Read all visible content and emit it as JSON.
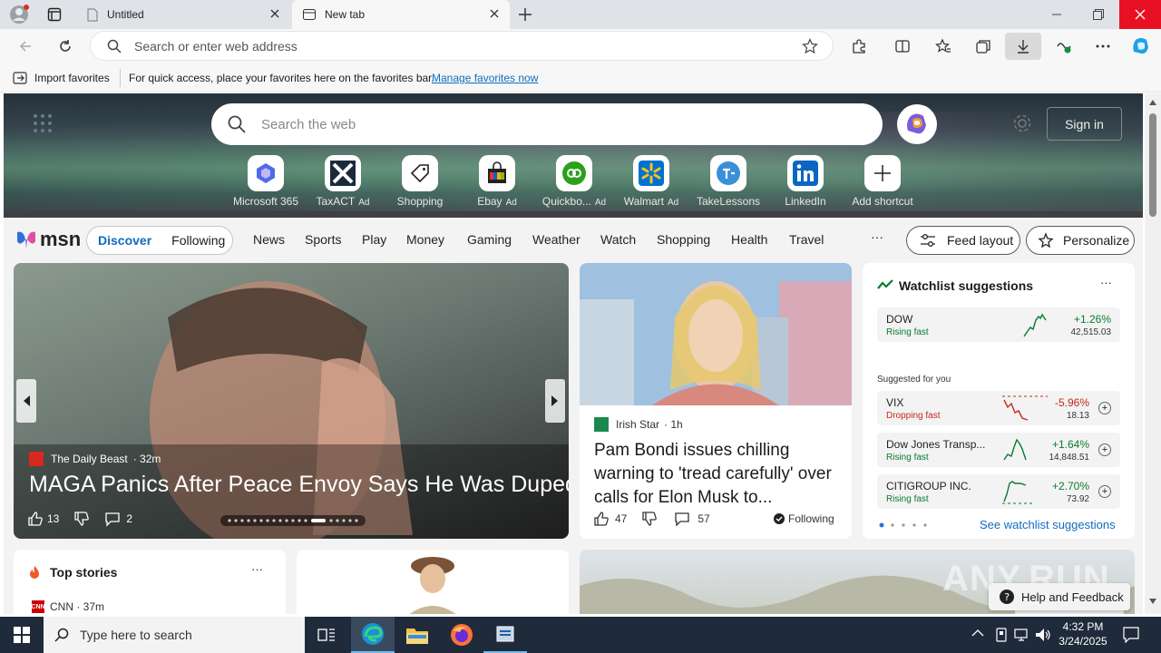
{
  "browser": {
    "tabs": [
      {
        "title": "Untitled"
      },
      {
        "title": "New tab"
      }
    ],
    "address_placeholder": "Search or enter web address"
  },
  "favorites_bar": {
    "import_label": "Import favorites",
    "message": "For quick access, place your favorites here on the favorites bar.",
    "manage_link": "Manage favorites now"
  },
  "new_tab": {
    "search_placeholder": "Search the web",
    "sign_in": "Sign in",
    "shortcuts": [
      {
        "label": "Microsoft 365",
        "ad": ""
      },
      {
        "label": "TaxACT",
        "ad": "Ad"
      },
      {
        "label": "Shopping",
        "ad": ""
      },
      {
        "label": "Ebay",
        "ad": "Ad"
      },
      {
        "label": "Quickbo...",
        "ad": "Ad"
      },
      {
        "label": "Walmart",
        "ad": "Ad"
      },
      {
        "label": "TakeLessons",
        "ad": ""
      },
      {
        "label": "LinkedIn",
        "ad": ""
      },
      {
        "label": "Add shortcut",
        "ad": ""
      }
    ]
  },
  "msn_nav": {
    "brand": "msn",
    "discover": "Discover",
    "following": "Following",
    "items": [
      "News",
      "Sports",
      "Play",
      "Money",
      "Gaming",
      "Weather",
      "Watch",
      "Shopping",
      "Health",
      "Travel"
    ],
    "more": "···",
    "feed_layout": "Feed layout",
    "personalize": "Personalize"
  },
  "hero_story": {
    "source": "The Daily Beast",
    "time": "· 32m",
    "headline": "MAGA Panics After Peace Envoy Says He Was Duped",
    "likes": "13",
    "comments": "2"
  },
  "story2": {
    "source": "Irish Star",
    "time": "· 1h",
    "headline": "Pam Bondi issues chilling warning to 'tread carefully' over calls for Elon Musk to...",
    "likes": "47",
    "comments": "57",
    "following": "Following"
  },
  "watchlist": {
    "title": "Watchlist suggestions",
    "more": "···",
    "suggested_label": "Suggested for you",
    "see_more": "See watchlist suggestions",
    "items": [
      {
        "name": "DOW",
        "status": "Rising fast",
        "change": "+1.26%",
        "value": "42,515.03",
        "color": "#0a7b2e"
      },
      {
        "name": "VIX",
        "status": "Dropping fast",
        "change": "-5.96%",
        "value": "18.13",
        "color": "#c5281c"
      },
      {
        "name": "Dow Jones Transp...",
        "status": "Rising fast",
        "change": "+1.64%",
        "value": "14,848.51",
        "color": "#0a7b2e"
      },
      {
        "name": "CITIGROUP INC.",
        "status": "Rising fast",
        "change": "+2.70%",
        "value": "73.92",
        "color": "#0a7b2e"
      }
    ]
  },
  "top_stories": {
    "title": "Top stories",
    "more": "···",
    "first_source": "CNN · 37m"
  },
  "help_feedback": "Help and Feedback",
  "watermark": "ANY.RUN",
  "taskbar": {
    "search_placeholder": "Type here to search",
    "time": "4:32 PM",
    "date": "3/24/2025"
  },
  "colors": {
    "accent": "#0f6cbd",
    "rising": "#0a7b2e",
    "falling": "#c5281c",
    "taskbar": "#1f2b3a"
  }
}
